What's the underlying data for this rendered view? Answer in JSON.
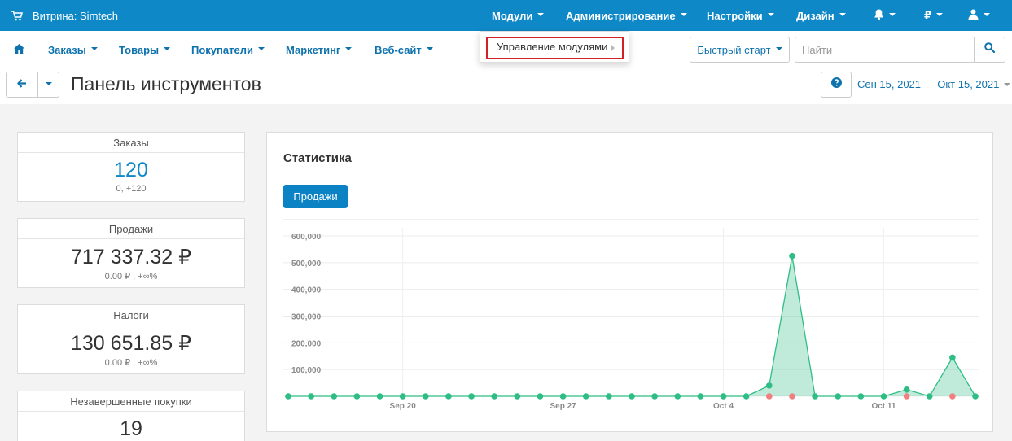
{
  "topbar": {
    "storefront": "Витрина: Simtech",
    "menus": [
      "Модули",
      "Администрирование",
      "Настройки",
      "Дизайн"
    ],
    "currency": "₽"
  },
  "dropdown": {
    "item": "Управление модулями"
  },
  "nav": {
    "items": [
      "Заказы",
      "Товары",
      "Покупатели",
      "Маркетинг",
      "Веб-сайт"
    ],
    "quick_start": "Быстрый старт",
    "search_placeholder": "Найти"
  },
  "page": {
    "title": "Панель инструментов",
    "date_range": "Сен 15, 2021 — Окт 15, 2021"
  },
  "cards": [
    {
      "title": "Заказы",
      "value": "120",
      "sub": "0, +120"
    },
    {
      "title": "Продажи",
      "value": "717 337.32 ₽",
      "sub": "0.00 ₽ , +∞%"
    },
    {
      "title": "Налоги",
      "value": "130 651.85 ₽",
      "sub": "0.00 ₽ , +∞%"
    },
    {
      "title": "Незавершенные покупки",
      "value": "19",
      "sub": ""
    }
  ],
  "stats": {
    "title": "Статистика",
    "tab_sales": "Продажи"
  },
  "colors": {
    "topbar": "#0f88c8",
    "link": "#0e72ad",
    "accent": "#0b82c4",
    "highlight_border": "#d42027",
    "series_current": "#2ebd85",
    "series_previous": "#f08080"
  },
  "chart_data": {
    "type": "area",
    "x_tick_labels": [
      "Sep 20",
      "Sep 27",
      "Oct 4",
      "Oct 11"
    ],
    "y_tick_labels": [
      "600,000",
      "500,000",
      "400,000",
      "300,000",
      "200,000",
      "100,000"
    ],
    "ylim": [
      0,
      600000
    ],
    "x": [
      "Sep 15",
      "Sep 16",
      "Sep 17",
      "Sep 18",
      "Sep 19",
      "Sep 20",
      "Sep 21",
      "Sep 22",
      "Sep 23",
      "Sep 24",
      "Sep 25",
      "Sep 26",
      "Sep 27",
      "Sep 28",
      "Sep 29",
      "Sep 30",
      "Oct 1",
      "Oct 2",
      "Oct 3",
      "Oct 4",
      "Oct 5",
      "Oct 6",
      "Oct 7",
      "Oct 8",
      "Oct 9",
      "Oct 10",
      "Oct 11",
      "Oct 12",
      "Oct 13",
      "Oct 14",
      "Oct 15"
    ],
    "series": [
      {
        "color": "#2ebd85",
        "values": [
          0,
          0,
          0,
          0,
          0,
          0,
          0,
          0,
          0,
          0,
          0,
          0,
          0,
          0,
          0,
          0,
          0,
          0,
          0,
          0,
          0,
          40000,
          525000,
          0,
          0,
          0,
          0,
          25000,
          0,
          145000,
          0
        ]
      },
      {
        "color": "#f08080",
        "values": [
          null,
          null,
          null,
          null,
          null,
          null,
          null,
          null,
          null,
          null,
          null,
          null,
          null,
          null,
          null,
          null,
          null,
          null,
          null,
          null,
          null,
          0,
          0,
          null,
          null,
          null,
          null,
          0,
          null,
          0,
          null
        ]
      }
    ]
  }
}
